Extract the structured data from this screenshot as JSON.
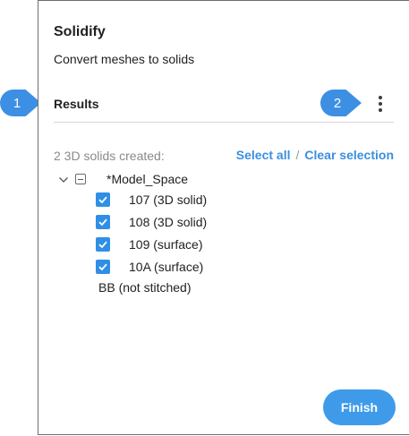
{
  "panel": {
    "title": "Solidify",
    "subtitle": "Convert meshes to solids"
  },
  "results": {
    "label": "Results",
    "menu_icon": "more-vertical-icon",
    "created_text": "2 3D solids created:",
    "select_all": "Select all",
    "separator": "/",
    "clear_selection": "Clear selection"
  },
  "tree": {
    "expand_icon": "chevron-down-icon",
    "collapse_icon": "minus-square-icon",
    "root_label": "*Model_Space",
    "items": [
      {
        "label": "107 (3D solid)",
        "checked": true
      },
      {
        "label": "108 (3D solid)",
        "checked": true
      },
      {
        "label": "109 (surface)",
        "checked": true
      },
      {
        "label": "10A (surface)",
        "checked": true
      }
    ],
    "unchecked_item": "BB (not stitched)"
  },
  "actions": {
    "finish": "Finish"
  },
  "callouts": [
    "1",
    "2"
  ],
  "colors": {
    "accent": "#3b8fe0",
    "checkbox": "#2f8fe6",
    "muted_text": "#8a8a8a"
  }
}
